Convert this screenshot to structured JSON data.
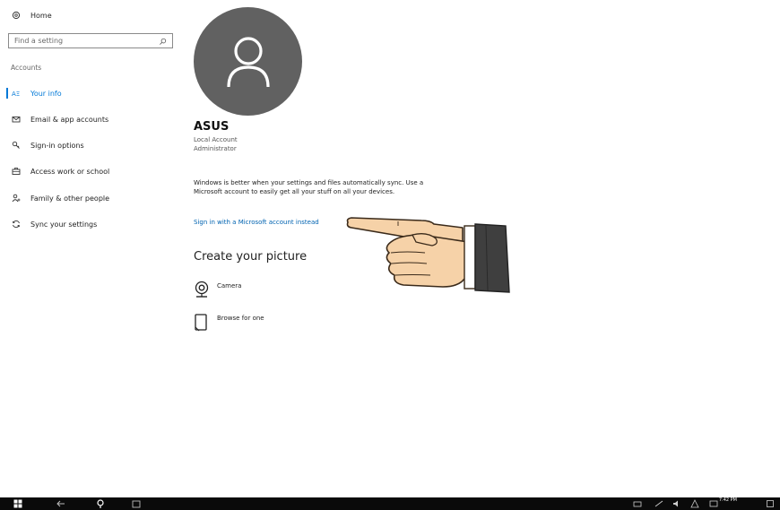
{
  "sidebar": {
    "home_label": "Home",
    "search_placeholder": "Find a setting",
    "section_label": "Accounts",
    "items": [
      {
        "label": "Your info",
        "icon": "person-card-icon",
        "active": true
      },
      {
        "label": "Email & app accounts",
        "icon": "mail-icon"
      },
      {
        "label": "Sign-in options",
        "icon": "key-icon"
      },
      {
        "label": "Access work or school",
        "icon": "briefcase-icon"
      },
      {
        "label": "Family & other people",
        "icon": "person-add-icon"
      },
      {
        "label": "Sync your settings",
        "icon": "sync-icon"
      }
    ]
  },
  "account": {
    "name": "ASUS",
    "type": "Local Account",
    "role": "Administrator",
    "sync_message": "Windows is better when your settings and files automatically sync. Use a Microsoft account to easily get all your stuff on all your devices.",
    "ms_link": "Sign in with a Microsoft account instead"
  },
  "picture": {
    "heading": "Create your picture",
    "options": [
      {
        "label": "Camera",
        "icon": "camera-icon"
      },
      {
        "label": "Browse for one",
        "icon": "browse-icon"
      }
    ]
  },
  "taskbar": {
    "clock": "7:42 PM"
  },
  "colors": {
    "accent": "#0078d7",
    "link": "#0063b1",
    "avatar": "#616161",
    "taskbar": "#0a0a0a"
  }
}
